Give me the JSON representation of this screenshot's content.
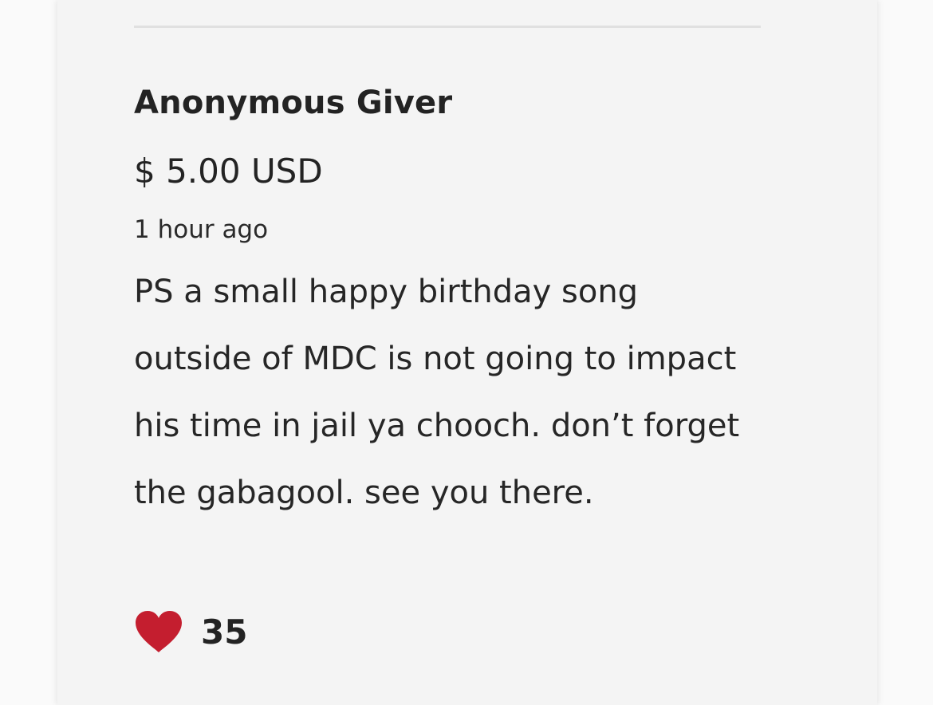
{
  "donation": {
    "donor_name": "Anonymous Giver",
    "amount": "$ 5.00 USD",
    "time_ago": "1 hour ago",
    "message": "PS a small happy birthday song outside of MDC is not going to impact his time in jail ya chooch. don’t forget the gabagool. see you there.",
    "like_icon": "heart-icon",
    "like_color": "#c41e2f",
    "like_count": "35"
  }
}
